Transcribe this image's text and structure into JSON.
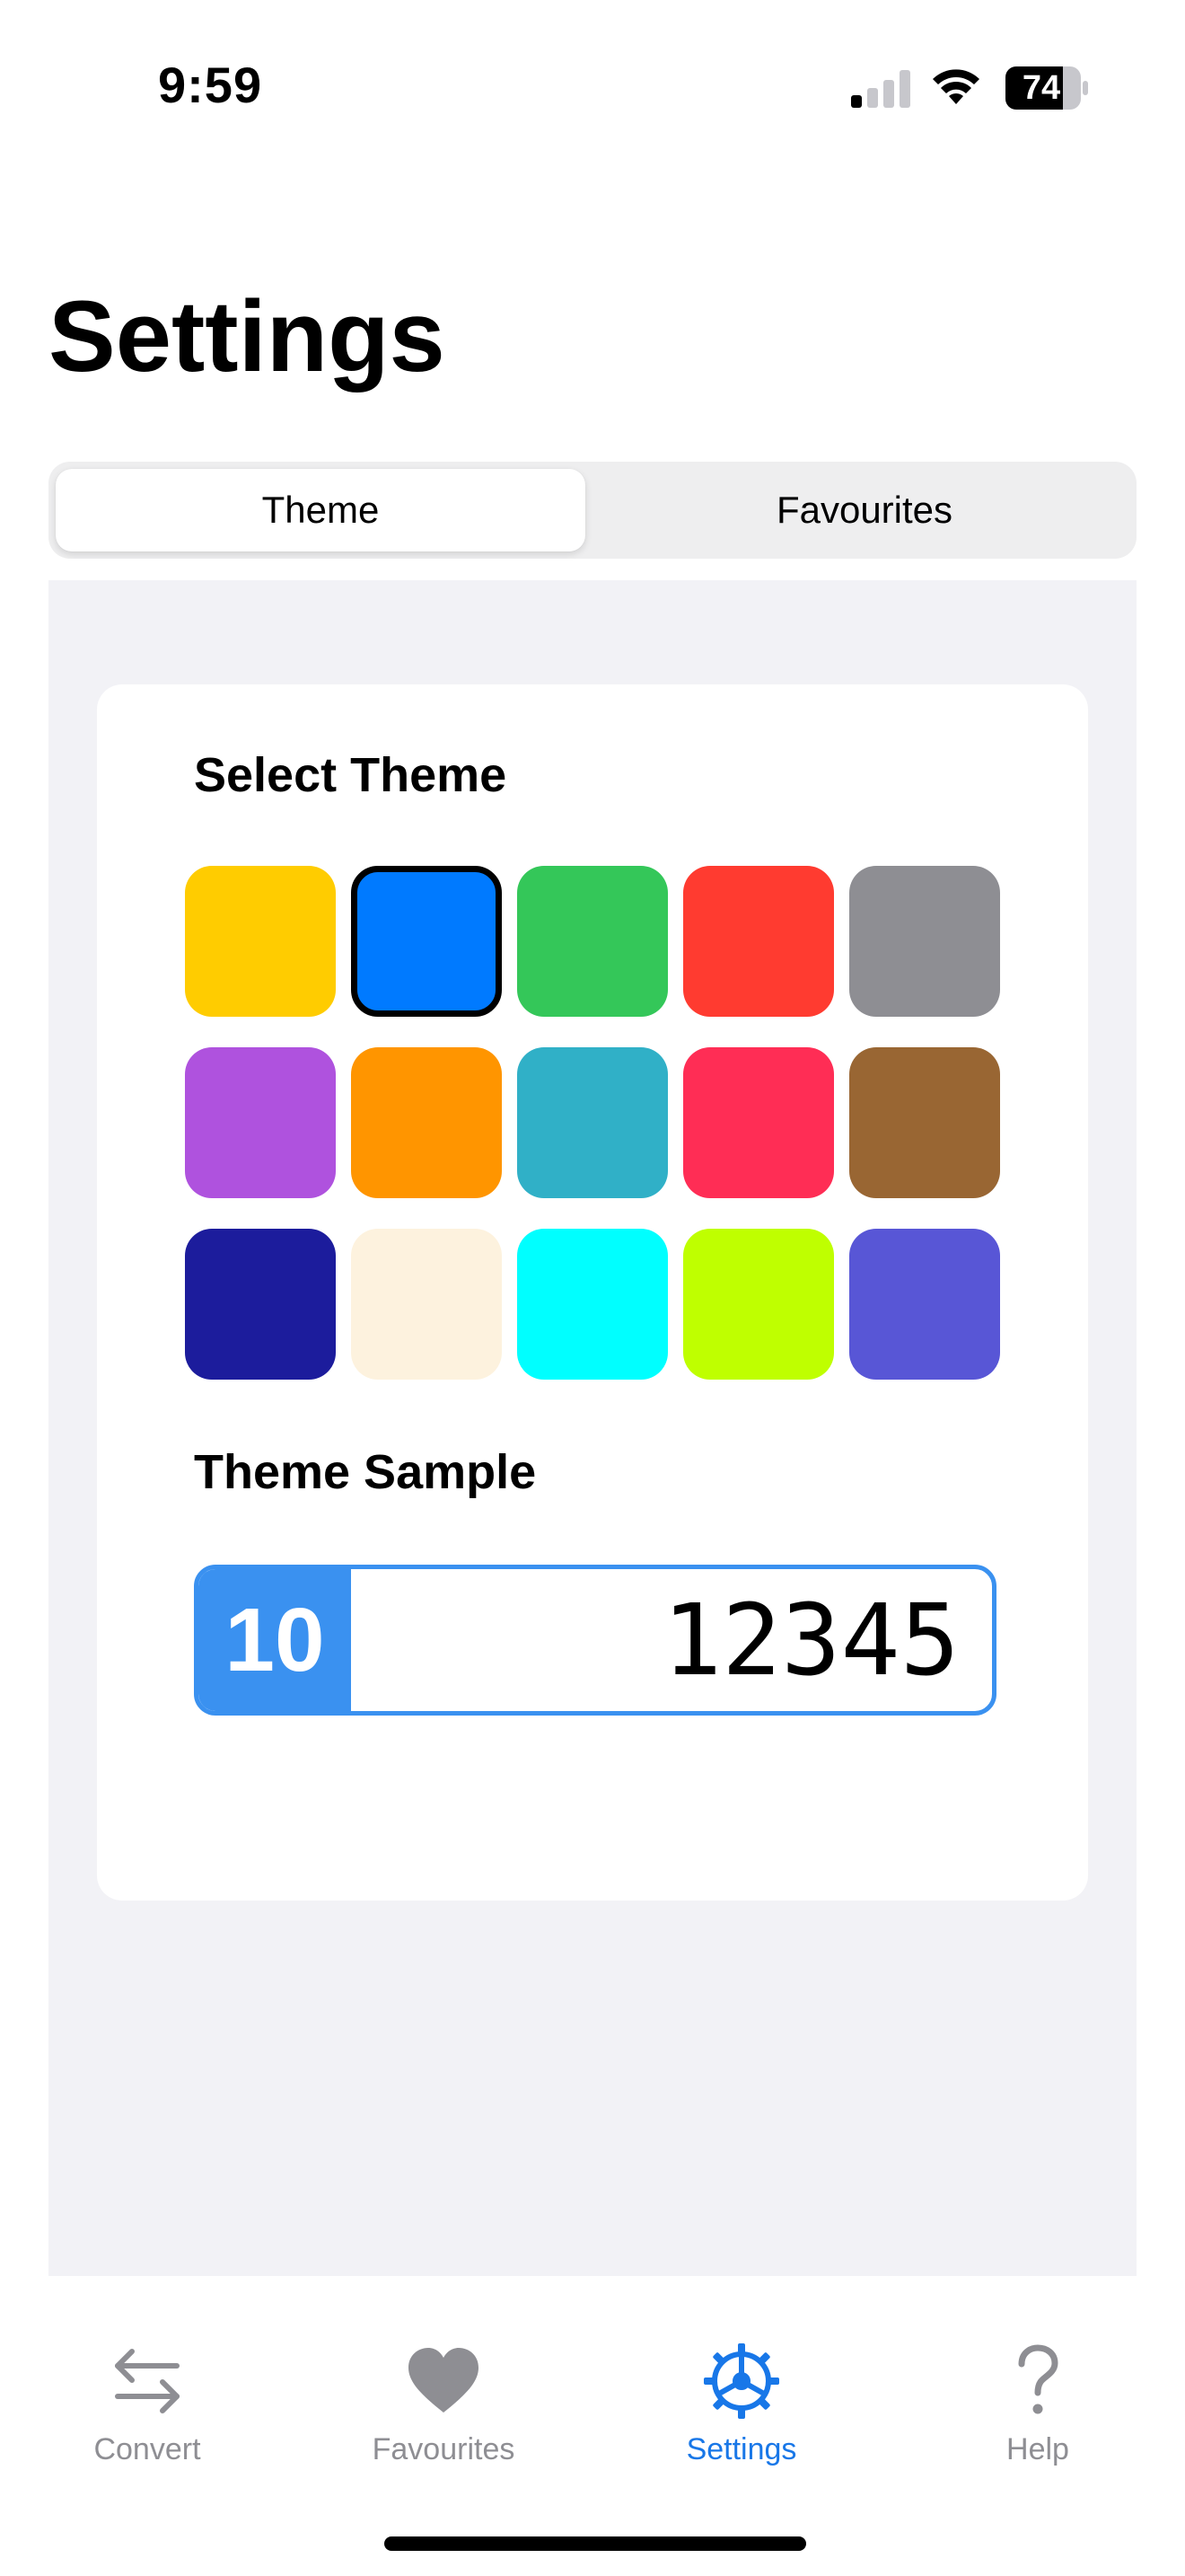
{
  "status_bar": {
    "time": "9:59",
    "battery": "74"
  },
  "header": {
    "title": "Settings"
  },
  "segments": [
    {
      "label": "Theme",
      "selected": true
    },
    {
      "label": "Favourites",
      "selected": false
    }
  ],
  "theme_card": {
    "select_label": "Select Theme",
    "swatches": [
      {
        "color": "#ffcc00",
        "selected": false
      },
      {
        "color": "#007aff",
        "selected": true
      },
      {
        "color": "#34c759",
        "selected": false
      },
      {
        "color": "#ff3b30",
        "selected": false
      },
      {
        "color": "#8e8e93",
        "selected": false
      },
      {
        "color": "#af52de",
        "selected": false
      },
      {
        "color": "#ff9500",
        "selected": false
      },
      {
        "color": "#30b0c7",
        "selected": false
      },
      {
        "color": "#ff2d55",
        "selected": false
      },
      {
        "color": "#996633",
        "selected": false
      },
      {
        "color": "#1c1c9c",
        "selected": false
      },
      {
        "color": "#fdf2de",
        "selected": false
      },
      {
        "color": "#00ffff",
        "selected": false
      },
      {
        "color": "#bfff00",
        "selected": false
      },
      {
        "color": "#5856d6",
        "selected": false
      }
    ],
    "sample_label": "Theme Sample",
    "sample": {
      "base": "10",
      "value": "12345",
      "accent_color": "#3a91f0"
    }
  },
  "tab_bar": {
    "items": [
      {
        "label": "Convert",
        "icon": "convert-arrows-icon",
        "active": false
      },
      {
        "label": "Favourites",
        "icon": "heart-icon",
        "active": false
      },
      {
        "label": "Settings",
        "icon": "gear-icon",
        "active": true
      },
      {
        "label": "Help",
        "icon": "question-mark-icon",
        "active": false
      }
    ],
    "active_color": "#1877e8",
    "inactive_color": "#8e8e93"
  }
}
